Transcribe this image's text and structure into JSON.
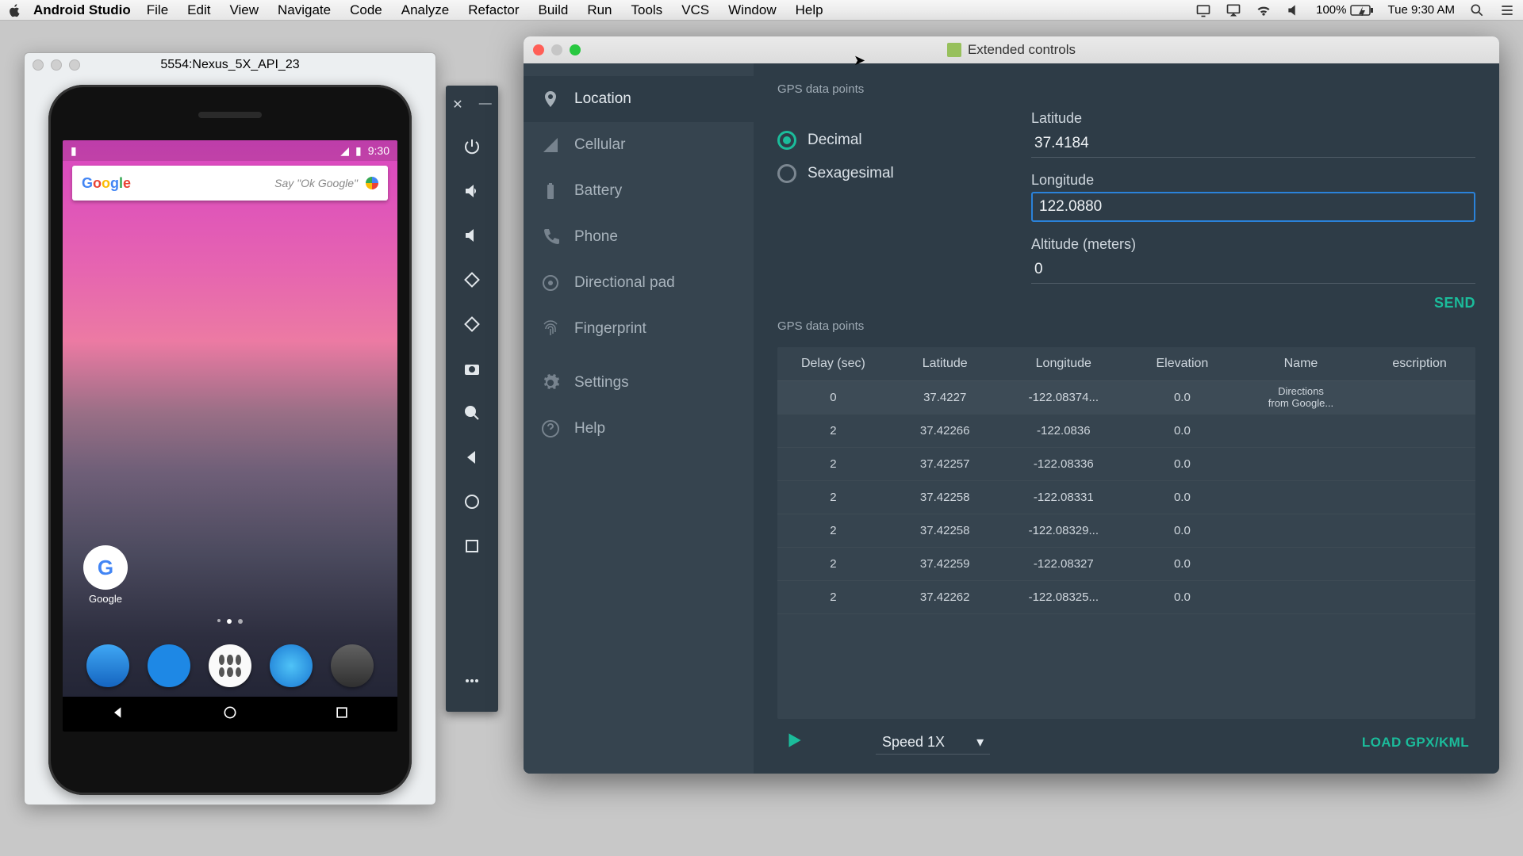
{
  "menubar": {
    "app": "Android Studio",
    "items": [
      "File",
      "Edit",
      "View",
      "Navigate",
      "Code",
      "Analyze",
      "Refactor",
      "Build",
      "Run",
      "Tools",
      "VCS",
      "Window",
      "Help"
    ],
    "battery": "100%",
    "clock": "Tue 9:30 AM"
  },
  "emulator_window": {
    "title": "5554:Nexus_5X_API_23",
    "status_time": "9:30",
    "search_hint": "Say \"Ok Google\"",
    "google_label": "Google"
  },
  "emu_toolbar": {
    "close": "✕",
    "min": "—"
  },
  "extended": {
    "title": "Extended controls",
    "nav": [
      {
        "key": "location",
        "label": "Location",
        "active": true
      },
      {
        "key": "cellular",
        "label": "Cellular"
      },
      {
        "key": "battery",
        "label": "Battery"
      },
      {
        "key": "phone",
        "label": "Phone"
      },
      {
        "key": "dpad",
        "label": "Directional pad"
      },
      {
        "key": "fingerprint",
        "label": "Fingerprint"
      },
      {
        "key": "settings",
        "label": "Settings"
      },
      {
        "key": "help",
        "label": "Help"
      }
    ],
    "gps_header": "GPS data points",
    "radios": {
      "decimal": "Decimal",
      "sexagesimal": "Sexagesimal",
      "selected": "decimal"
    },
    "fields": {
      "lat_label": "Latitude",
      "lat_value": "37.4184",
      "lon_label": "Longitude",
      "lon_value": "122.0880",
      "alt_label": "Altitude (meters)",
      "alt_value": "0"
    },
    "send": "SEND",
    "table_header": "GPS data points",
    "columns": [
      "Delay (sec)",
      "Latitude",
      "Longitude",
      "Elevation",
      "Name",
      "escription"
    ],
    "rows": [
      {
        "delay": "0",
        "lat": "37.4227",
        "lon": "-122.08374...",
        "elev": "0.0",
        "name": "Directions\nfrom Google...",
        "desc": ""
      },
      {
        "delay": "2",
        "lat": "37.42266",
        "lon": "-122.0836",
        "elev": "0.0",
        "name": "",
        "desc": ""
      },
      {
        "delay": "2",
        "lat": "37.42257",
        "lon": "-122.08336",
        "elev": "0.0",
        "name": "",
        "desc": ""
      },
      {
        "delay": "2",
        "lat": "37.42258",
        "lon": "-122.08331",
        "elev": "0.0",
        "name": "",
        "desc": ""
      },
      {
        "delay": "2",
        "lat": "37.42258",
        "lon": "-122.08329...",
        "elev": "0.0",
        "name": "",
        "desc": ""
      },
      {
        "delay": "2",
        "lat": "37.42259",
        "lon": "-122.08327",
        "elev": "0.0",
        "name": "",
        "desc": ""
      },
      {
        "delay": "2",
        "lat": "37.42262",
        "lon": "-122.08325...",
        "elev": "0.0",
        "name": "",
        "desc": ""
      }
    ],
    "speed": "Speed 1X",
    "load": "LOAD GPX/KML"
  }
}
